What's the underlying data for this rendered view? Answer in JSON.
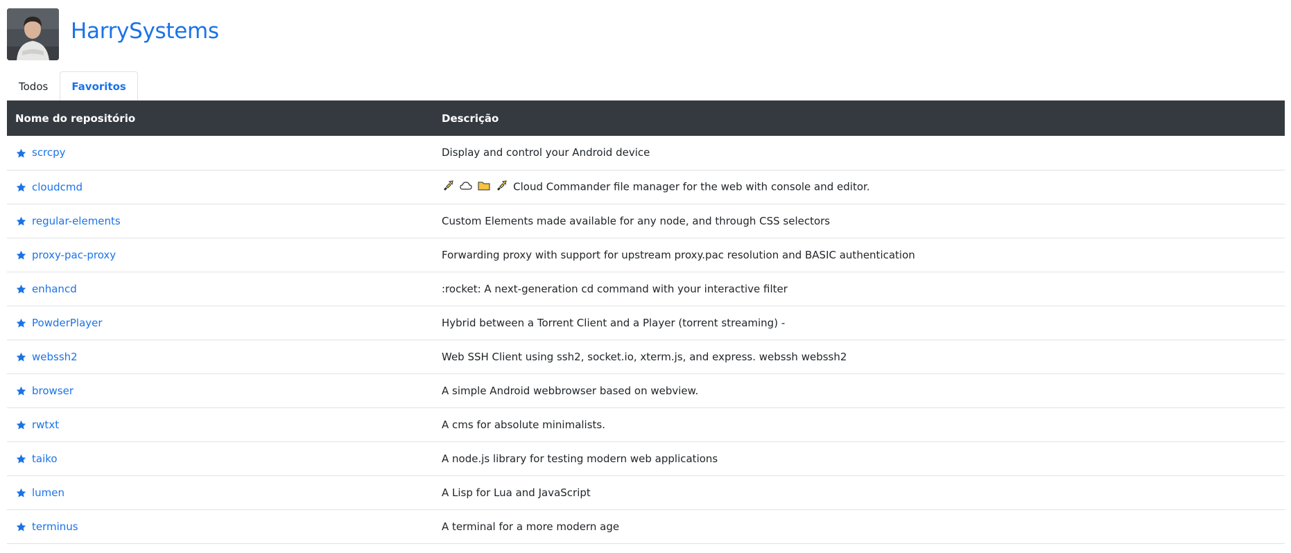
{
  "header": {
    "title": "HarrySystems"
  },
  "tabs": [
    {
      "label": "Todos",
      "active": false
    },
    {
      "label": "Favoritos",
      "active": true
    }
  ],
  "table": {
    "headers": {
      "name": "Nome do repositório",
      "description": "Descrição"
    },
    "rows": [
      {
        "name": "scrcpy",
        "description": "Display and control your Android device",
        "icon": "star-icon"
      },
      {
        "name": "cloudcmd",
        "description": "Cloud Commander file manager for the web with console and editor.",
        "icon": "star-icon",
        "description_icons": [
          "satellite-icon",
          "cloud-icon",
          "folder-icon",
          "satellite-icon"
        ]
      },
      {
        "name": "regular-elements",
        "description": "Custom Elements made available for any node, and through CSS selectors",
        "icon": "star-icon"
      },
      {
        "name": "proxy-pac-proxy",
        "description": "Forwarding proxy with support for upstream proxy.pac resolution and BASIC authentication",
        "icon": "star-icon"
      },
      {
        "name": "enhancd",
        "description": ":rocket: A next-generation cd command with your interactive filter",
        "icon": "star-icon"
      },
      {
        "name": "PowderPlayer",
        "description": "Hybrid between a Torrent Client and a Player (torrent streaming) -",
        "icon": "star-icon"
      },
      {
        "name": "webssh2",
        "description": "Web SSH Client using ssh2, socket.io, xterm.js, and express. webssh webssh2",
        "icon": "star-icon"
      },
      {
        "name": "browser",
        "description": "A simple Android webbrowser based on webview.",
        "icon": "star-icon"
      },
      {
        "name": "rwtxt",
        "description": "A cms for absolute minimalists.",
        "icon": "star-icon"
      },
      {
        "name": "taiko",
        "description": "A node.js library for testing modern web applications",
        "icon": "star-icon"
      },
      {
        "name": "lumen",
        "description": "A Lisp for Lua and JavaScript",
        "icon": "star-icon"
      },
      {
        "name": "terminus",
        "description": "A terminal for a more modern age",
        "icon": "star-icon"
      }
    ]
  },
  "colors": {
    "accent": "#1a73e8",
    "header_bg": "#343a40",
    "border": "#dee2e6"
  }
}
